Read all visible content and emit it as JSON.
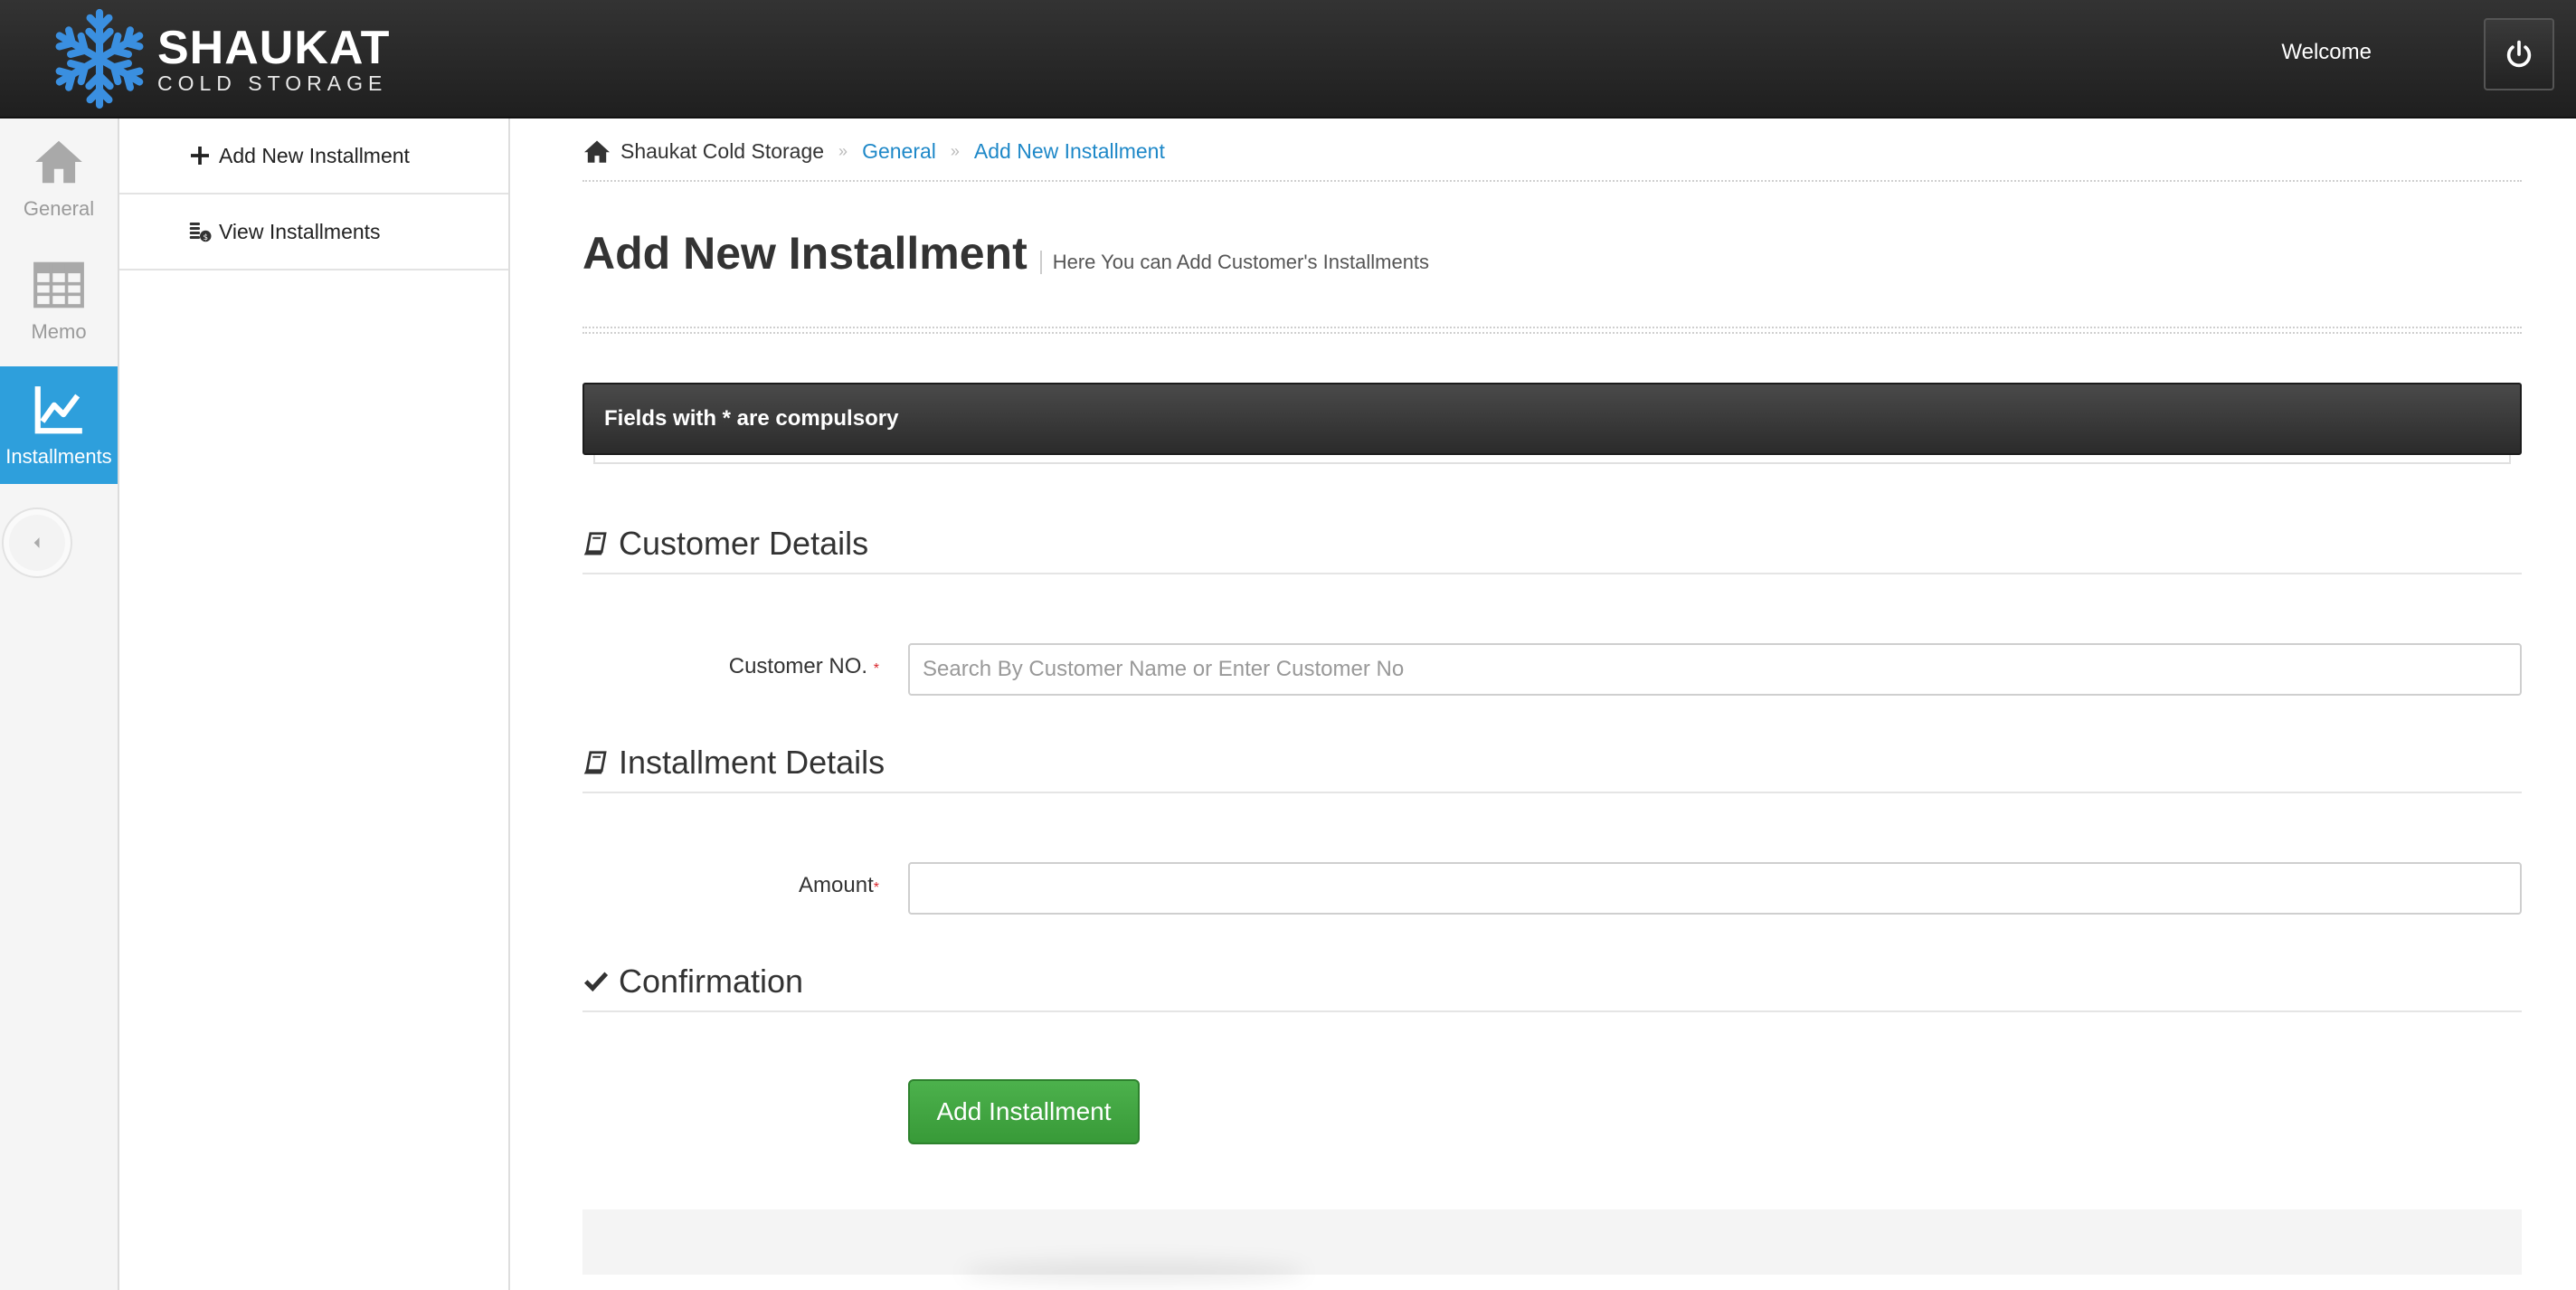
{
  "brand": {
    "name": "SHAUKAT",
    "tagline": "COLD STORAGE"
  },
  "header": {
    "welcome": "Welcome"
  },
  "rail": {
    "items": [
      {
        "label": "General",
        "icon": "home-icon"
      },
      {
        "label": "Memo",
        "icon": "table-grid-icon"
      },
      {
        "label": "Installments",
        "icon": "line-chart-icon",
        "active": true
      }
    ]
  },
  "subnav": {
    "items": [
      {
        "label": "Add New Installment",
        "icon": "plus-icon"
      },
      {
        "label": "View Installments",
        "icon": "coins-icon"
      }
    ]
  },
  "breadcrumb": {
    "home": "Shaukat Cold Storage",
    "sep": "»",
    "items": [
      "General",
      "Add New Installment"
    ]
  },
  "page": {
    "title": "Add New Installment",
    "subtitle": "Here You can Add Customer's Installments"
  },
  "notice": "Fields with * are compulsory",
  "sections": {
    "customer": "Customer Details",
    "installment": "Installment Details",
    "confirmation": "Confirmation"
  },
  "form": {
    "customer_label": "Customer NO. ",
    "customer_placeholder": "Search By Customer Name or Enter Customer No",
    "amount_label": "Amount",
    "required_mark": "*",
    "submit": "Add Installment"
  },
  "colors": {
    "accent": "#2e9fdc",
    "link": "#1e88c8",
    "success": "#43a843",
    "required": "#d9262c"
  }
}
